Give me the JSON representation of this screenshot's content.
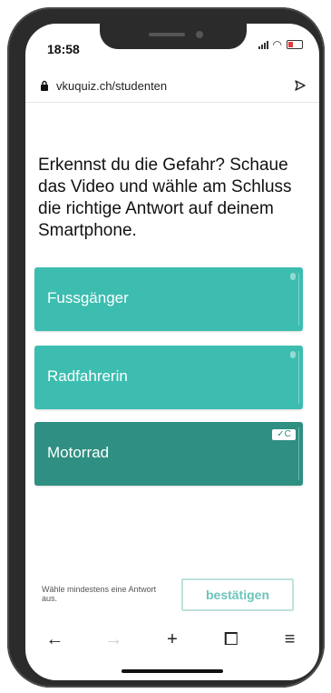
{
  "status_bar": {
    "time": "18:58"
  },
  "browser": {
    "url": "vkuquiz.ch/studenten"
  },
  "question": {
    "text": "Erkennst du die Gefahr? Schaue das Video und wähle am Schluss die richtige Antwort auf deinem Smartphone."
  },
  "answers": [
    {
      "label": "Fussgänger",
      "selected": false,
      "color": "#3cbdb0"
    },
    {
      "label": "Radfahrerin",
      "selected": false,
      "color": "#3cbdb0"
    },
    {
      "label": "Motorrad",
      "selected": true,
      "color": "#2e8f82",
      "badge": "✓C"
    }
  ],
  "footer": {
    "hint": "Wähle mindestens eine Antwort aus.",
    "confirm_label": "bestätigen"
  },
  "toolbar": {
    "back": "←",
    "forward": "→",
    "new_tab": "+",
    "tabs": "⧠",
    "menu": "≡"
  }
}
